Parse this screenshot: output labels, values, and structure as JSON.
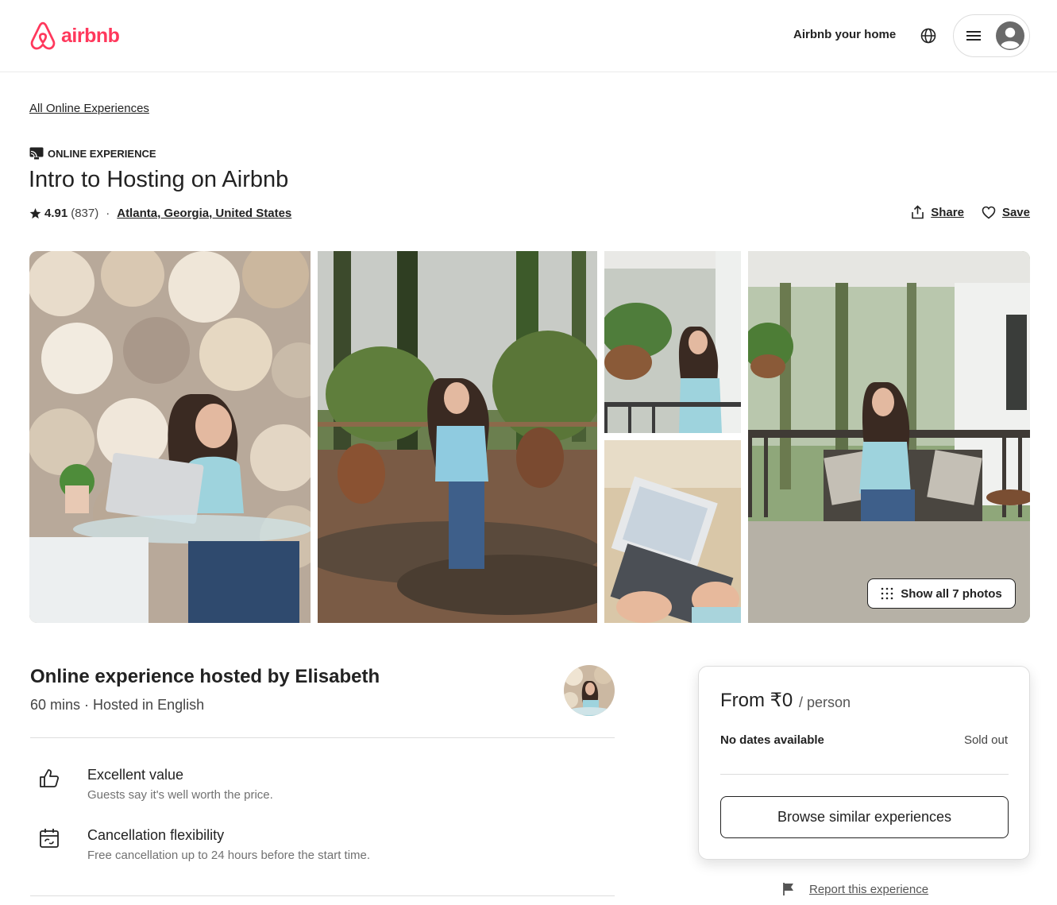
{
  "header": {
    "brand": "airbnb",
    "host_link": "Airbnb your home"
  },
  "breadcrumb": "All Online Experiences",
  "experience": {
    "kicker": "ONLINE EXPERIENCE",
    "title": "Intro to Hosting on Airbnb",
    "rating": "4.91",
    "reviews": "(837)",
    "location": "Atlanta, Georgia, United States",
    "share_label": "Share",
    "save_label": "Save"
  },
  "gallery": {
    "show_all_label": "Show all 7 photos"
  },
  "host": {
    "title": "Online experience hosted by Elisabeth",
    "subtitle": "60 mins · Hosted in English"
  },
  "features": [
    {
      "icon": "thumbs-up-icon",
      "title": "Excellent value",
      "desc": "Guests say it's well worth the price."
    },
    {
      "icon": "calendar-icon",
      "title": "Cancellation flexibility",
      "desc": "Free cancellation up to 24 hours before the start time."
    }
  ],
  "booking": {
    "price": "From ₹0",
    "per": "/ person",
    "no_dates": "No dates available",
    "status": "Sold out",
    "browse_label": "Browse similar experiences"
  },
  "report_label": "Report this experience",
  "colors": {
    "brand": "#ff385c",
    "text": "#222222",
    "muted": "#717171",
    "border": "#dddddd"
  }
}
